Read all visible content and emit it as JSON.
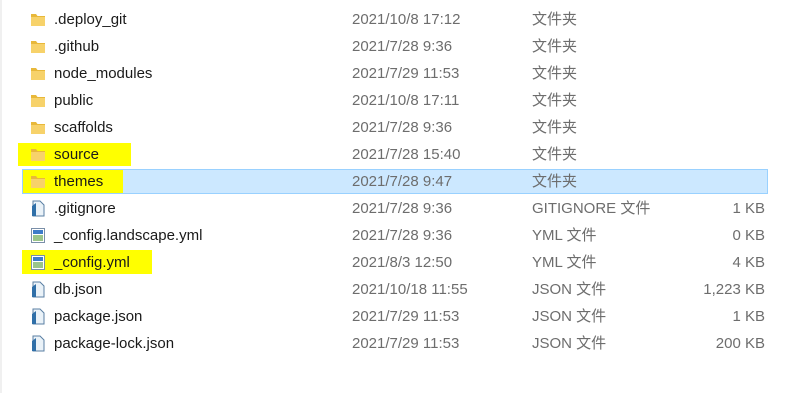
{
  "files": [
    {
      "name": ".deploy_git",
      "date": "2021/10/8 17:12",
      "type": "文件夹",
      "size": "",
      "icon": "folder-icon"
    },
    {
      "name": ".github",
      "date": "2021/7/28 9:36",
      "type": "文件夹",
      "size": "",
      "icon": "folder-icon"
    },
    {
      "name": "node_modules",
      "date": "2021/7/29 11:53",
      "type": "文件夹",
      "size": "",
      "icon": "folder-icon"
    },
    {
      "name": "public",
      "date": "2021/10/8 17:11",
      "type": "文件夹",
      "size": "",
      "icon": "folder-icon"
    },
    {
      "name": "scaffolds",
      "date": "2021/7/28 9:36",
      "type": "文件夹",
      "size": "",
      "icon": "folder-icon"
    },
    {
      "name": "source",
      "date": "2021/7/28 15:40",
      "type": "文件夹",
      "size": "",
      "icon": "folder-icon"
    },
    {
      "name": "themes",
      "date": "2021/7/28 9:47",
      "type": "文件夹",
      "size": "",
      "icon": "folder-icon"
    },
    {
      "name": ".gitignore",
      "date": "2021/7/28 9:36",
      "type": "GITIGNORE 文件",
      "size": "1 KB",
      "icon": "text-file-icon"
    },
    {
      "name": "_config.landscape.yml",
      "date": "2021/7/28 9:36",
      "type": "YML 文件",
      "size": "0 KB",
      "icon": "yml-file-icon"
    },
    {
      "name": "_config.yml",
      "date": "2021/8/3 12:50",
      "type": "YML 文件",
      "size": "4 KB",
      "icon": "yml-file-icon"
    },
    {
      "name": "db.json",
      "date": "2021/10/18 11:55",
      "type": "JSON 文件",
      "size": "1,223 KB",
      "icon": "text-file-icon"
    },
    {
      "name": "package.json",
      "date": "2021/7/29 11:53",
      "type": "JSON 文件",
      "size": "1 KB",
      "icon": "text-file-icon"
    },
    {
      "name": "package-lock.json",
      "date": "2021/7/29 11:53",
      "type": "JSON 文件",
      "size": "200 KB",
      "icon": "text-file-icon"
    }
  ],
  "selected_row": "themes",
  "highlighted_rows": [
    "source",
    "themes",
    "_config.yml"
  ],
  "colors": {
    "highlight": "#ffff00",
    "selection_fill": "#cce8ff",
    "selection_border": "#99d1ff",
    "folder": "#f5c542",
    "secondary_text": "#6d6d6d"
  }
}
